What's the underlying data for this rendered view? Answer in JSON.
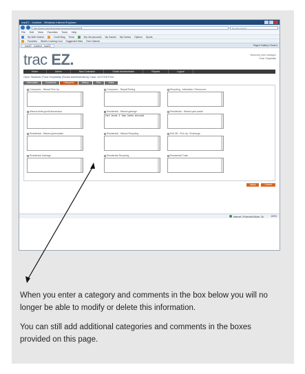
{
  "browser": {
    "window_title": "tracEZ - Incident - Windows Internet Explorer",
    "address": "http://tracez.example/incident/view.aspx?id=4127478",
    "search_placeholder": "My Web Search",
    "menu": [
      "File",
      "Edit",
      "View",
      "Favorites",
      "Tools",
      "Help"
    ],
    "toolbar_items": [
      "My Web Search",
      "Coolit Blog",
      "Trivia",
      "My Cat (account)",
      "My Games",
      "My Horses",
      "Options",
      "Sports"
    ],
    "favorites_bar": [
      "Favorites",
      "What's Cooking Cool",
      "Suggested Sites",
      "Free Hotmail"
    ],
    "tab_label": "tracEZ - Incident - tracEZ",
    "status_zone": "Internet | Protected Mode: On",
    "zoom": "100%"
  },
  "app": {
    "logo_main": "trac",
    "logo_accent": "EZ.",
    "welcome_line_1": "Welcome: john rodriquez",
    "welcome_line_2": "Trust: Hospitality",
    "nav": [
      "Home",
      "Admin",
      "New Contractor",
      "Global Administration",
      "Reports",
      "Logout"
    ],
    "case_text": "Open Students (Trust Hospitality (Studio Administration))  Case: 4127478  Print",
    "category_tabs": [
      {
        "label": "Information",
        "active": false
      },
      {
        "label": "Comments",
        "active": false
      },
      {
        "label": "Categories",
        "active": true
      },
      {
        "label": "History",
        "active": false
      },
      {
        "label": "Files",
        "active": false
      },
      {
        "label": "Notes",
        "active": false
      }
    ],
    "fields": [
      {
        "label": "Compactor - Missed Pick Up",
        "text": ""
      },
      {
        "label": "Compactor - Repair/Testing",
        "text": ""
      },
      {
        "label": "Recycling - Infestation / Resources",
        "text": ""
      },
      {
        "label": "Missed white goods/Hazardous",
        "text": ""
      },
      {
        "label": "Residential - Missed garbage",
        "text": "Cat area 1 has been missed"
      },
      {
        "label": "Residential - Missed yard waste",
        "text": ""
      },
      {
        "label": "Residential - Missed greenwaste",
        "text": ""
      },
      {
        "label": "Residential - Missed Recycling",
        "text": ""
      },
      {
        "label": "Roll Off - Pick Up / Exchange",
        "text": ""
      },
      {
        "label": "Residential Garbage",
        "text": ""
      },
      {
        "label": "Residential Recycling",
        "text": ""
      },
      {
        "label": "Residential Trash",
        "text": ""
      }
    ],
    "actions": [
      "Apply",
      "Cancel"
    ]
  },
  "instructions": {
    "paragraph_1": "When you enter a category and comments in the box below you will no longer be able to modify or delete this information.",
    "paragraph_2": "You can still add additional categories and comments in the boxes provided on this page."
  },
  "colors": {
    "accent_orange": "#c4551f",
    "nav_dark": "#3b3b3b",
    "ie_blue": "#1f4a7a",
    "frame_gray": "#e7e7e7"
  }
}
